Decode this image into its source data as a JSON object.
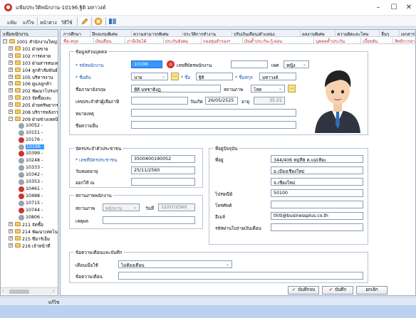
{
  "window": {
    "title": "แฟ้มประวัติพนักงาน-10196.ฐิติ มหาวงค์",
    "controls": {
      "minimize": "–",
      "maximize": "☐",
      "close": "✕"
    }
  },
  "toolbar": {
    "file": "แฟ้ม",
    "edit": "แก้ไข",
    "window": "หน้าต่าง",
    "help": "วิธีใช้"
  },
  "tree": {
    "header": "แฟ้มพนักงาน",
    "items": [
      {
        "label": "1001 สำนักงานใหญ่",
        "level": 0,
        "type": "folder",
        "expanded": true
      },
      {
        "label": "101 ฝ่ายขาย",
        "level": 1,
        "type": "folder"
      },
      {
        "label": "102 การตลาด",
        "level": 1,
        "type": "folder"
      },
      {
        "label": "103 ฝ่ายสารสนเทศ",
        "level": 1,
        "type": "folder"
      },
      {
        "label": "104 ลูกค้าสัมพันธ์",
        "level": 1,
        "type": "folder"
      },
      {
        "label": "105 บริหารงาน",
        "level": 1,
        "type": "folder"
      },
      {
        "label": "106 ดูแลลูกค้า",
        "level": 1,
        "type": "folder"
      },
      {
        "label": "202 พัฒนาโปรแกรม",
        "level": 1,
        "type": "folder"
      },
      {
        "label": "203 จัดซื้อและ",
        "level": 1,
        "type": "folder"
      },
      {
        "label": "205 ฝ่ายทรัพยากร",
        "level": 1,
        "type": "folder"
      },
      {
        "label": "208 บริการหลังการขาย",
        "level": 1,
        "type": "folder"
      },
      {
        "label": "209 ฝ่ายช่างเทคนิค",
        "level": 1,
        "type": "folder",
        "expanded": true
      },
      {
        "label": "10052 - ",
        "level": 2,
        "type": "emp",
        "color": "#9aa4ad"
      },
      {
        "label": "10151 - ",
        "level": 2,
        "type": "emp",
        "color": "#9aa4ad"
      },
      {
        "label": "10176 - ",
        "level": 2,
        "type": "emp",
        "color": "#d0332e"
      },
      {
        "label": "10196 - ",
        "level": 2,
        "type": "emp",
        "color": "#9aa4ad",
        "selected": true
      },
      {
        "label": "10399 - ",
        "level": 2,
        "type": "emp",
        "color": "#d0332e"
      },
      {
        "label": "10248 - ",
        "level": 2,
        "type": "emp",
        "color": "#9aa4ad"
      },
      {
        "label": "10333 - ",
        "level": 2,
        "type": "emp",
        "color": "#9aa4ad"
      },
      {
        "label": "10342 - ",
        "level": 2,
        "type": "emp",
        "color": "#9aa4ad"
      },
      {
        "label": "10353 - ",
        "level": 2,
        "type": "emp",
        "color": "#9aa4ad"
      },
      {
        "label": "10461 - ",
        "level": 2,
        "type": "emp",
        "color": "#d0332e"
      },
      {
        "label": "10488 - ",
        "level": 2,
        "type": "emp",
        "color": "#d0332e"
      },
      {
        "label": "10715 - ",
        "level": 2,
        "type": "emp",
        "color": "#9aa4ad"
      },
      {
        "label": "10744 - ",
        "level": 2,
        "type": "emp",
        "color": "#d0332e"
      },
      {
        "label": "10806 - ",
        "level": 2,
        "type": "emp",
        "color": "#9aa4ad"
      },
      {
        "label": "211 จัดซื้อ",
        "level": 1,
        "type": "folder"
      },
      {
        "label": "214 พัฒนาเทคโนโลยี",
        "level": 1,
        "type": "folder"
      },
      {
        "label": "215 ซีอาร์เอ็ม",
        "level": 1,
        "type": "folder"
      },
      {
        "label": "216 เจ้าหน้าที่",
        "level": 1,
        "type": "folder"
      }
    ]
  },
  "tabs_row1": [
    "การศึกษา",
    "ฝึกอบรมพิเศษ",
    "ความสามารถพิเศษ",
    "ประวัติการทำงาน",
    "ปรับเงินเดือน/ตำแหน่ง",
    "ผลงานพิเศษ",
    "ความผิดและโทษ",
    "อื่นๆ",
    "เอกสารอื่นๆ"
  ],
  "tabs_row2": [
    "ชื่อ-สกุล",
    "เงินเดือน",
    "ภาษีเงินได้",
    "ประกันสังคม",
    "กองทุนสำรองฯ",
    "เงินค้ำประกัน-กู้-ผ่อน",
    "บุคคลค้ำประกัน",
    "เบี้ยขยัน",
    "สิทธิการลา",
    "ฝ่ายช่างที่",
    "ผู้สนรร",
    "แฟ้มบุคคล"
  ],
  "general": {
    "section_title": "ข้อมูลส่วนบุคคล",
    "emp_code_label": "* รหัสพนักงาน",
    "emp_code": "10196",
    "card_no_label": "เลขที่บัตรพนักงาน",
    "card_no": "",
    "gender_label": "เพศ",
    "gender": "หญิง",
    "prefix_label": "* ชื่อต้น",
    "prefix": "นาย",
    "first_name_label": "* ชื่อ",
    "first_name": "ฐิติ",
    "last_name_label": "* ชื่อสกุล",
    "last_name": "มหาวงค์",
    "eng_name_label": "ชื่อภาษาอังกฤษ",
    "eng_name": "ทู้ติ มหชาติงฎ",
    "marital_label": "สถานภาพ",
    "marital": "โสด",
    "taxid_label": "เลขประจำตัวผู้เสียภาษี",
    "taxid": "",
    "birthdate_label": "วันเกิด",
    "birthdate": "26/05/2525",
    "age_label": "อายุ",
    "age": "35.01",
    "note_label": "หมายเหตุ",
    "note": "",
    "nickname_label": "ชื่อความอื่น",
    "nickname": ""
  },
  "idcard": {
    "section_title": "บัตรประจำตัวประชาชน",
    "id_label": "* เลขที่บัตรประชาชน",
    "id": "3500400190052",
    "expiry_label": "วันหมดอายุ",
    "expiry": "25/11/2560",
    "issuer_label": "ออกให้ ณ",
    "issuer": ""
  },
  "address": {
    "section_title": "ที่อยู่ปัจจุบัน",
    "addr_label": "ที่อยู่",
    "addr1": "344/406 หมู่ที่8 ต.แม่เหียะ",
    "addr2": "อ.เมืองเชียงใหม่",
    "addr3": "จ.เชียงใหม่",
    "zip_label": "ไปรษณีย์",
    "zip": "50100",
    "phone_label": "โทรศัพท์",
    "phone": "",
    "email_label": "อีเมล์",
    "email": "thiti@businessplus.co.th",
    "pass_label": "รหัสผ่านใบจ่ายเงินเดือน",
    "pass": ""
  },
  "status": {
    "section_title": "สถานภาพพนักงาน",
    "state_label": "สถานภาพ",
    "state": "พนักงาน",
    "date_label": "วันที่",
    "date": "12/07/2560",
    "reason_label": "เหตุผล",
    "reason": ""
  },
  "alert": {
    "section_title": "ข้อความเตือนและบันทึก",
    "when_label": "เตือนเมื่อใช้",
    "when": "ไม่ต้องเตือน",
    "msg_label": "ข้อความเตือน",
    "msg": ""
  },
  "buttons": {
    "save_close": "บันทึกจบ",
    "save": "บันทึก",
    "cancel": "ยกเลิก"
  },
  "statusbar": {
    "text": "แก้ไข"
  },
  "colors": {
    "accent": "#c0272d",
    "label_blue": "#1f55b8",
    "selection": "#3399ff"
  }
}
